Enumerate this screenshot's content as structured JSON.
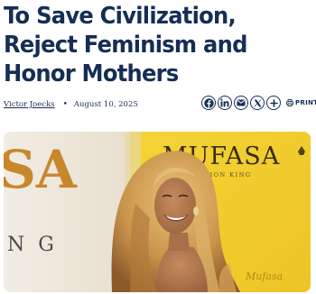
{
  "article": {
    "headline": "To Save Civilization, Reject Feminism and Honor Mothers",
    "author": "Victor Joecks",
    "date": "August 10, 2025",
    "bullet": "•"
  },
  "share": {
    "buttons": [
      {
        "name": "facebook",
        "icon": "facebook-icon"
      },
      {
        "name": "linkedin",
        "icon": "linkedin-icon"
      },
      {
        "name": "email",
        "icon": "email-icon"
      },
      {
        "name": "x",
        "icon": "x-icon"
      },
      {
        "name": "more",
        "icon": "plus-icon"
      }
    ],
    "print_label": "PRINT"
  },
  "photo": {
    "backdrop_text_left_top": "SA",
    "backdrop_text_left_bottom": "N G",
    "backdrop_text_right": "MUFASA",
    "backdrop_subtext_right": "THE LION KING"
  },
  "colors": {
    "headline": "#152e55",
    "backdrop_yellow": "#f2cf2e",
    "backdrop_gold_text": "#c8872c"
  }
}
